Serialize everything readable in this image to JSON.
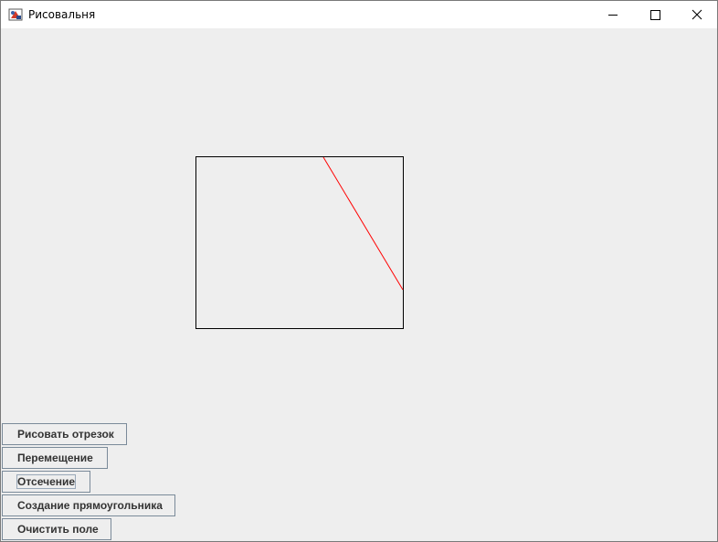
{
  "window": {
    "title": "Рисовальня",
    "icons": {
      "app": "java-app-icon",
      "minimize": "minimize-icon",
      "maximize": "maximize-icon",
      "close": "close-icon"
    }
  },
  "toolbar": {
    "buttons": [
      {
        "label": "Рисовать отрезок"
      },
      {
        "label": "Перемещение"
      },
      {
        "label": "Отсечение"
      },
      {
        "label": "Создание прямоугольника"
      },
      {
        "label": "Очистить поле"
      }
    ]
  },
  "drawing": {
    "rectangle_color": "#000000",
    "segment_color": "#ff0000"
  },
  "colors": {
    "background": "#eeeeee",
    "titlebar": "#ffffff",
    "button_border": "#7a8a99"
  }
}
